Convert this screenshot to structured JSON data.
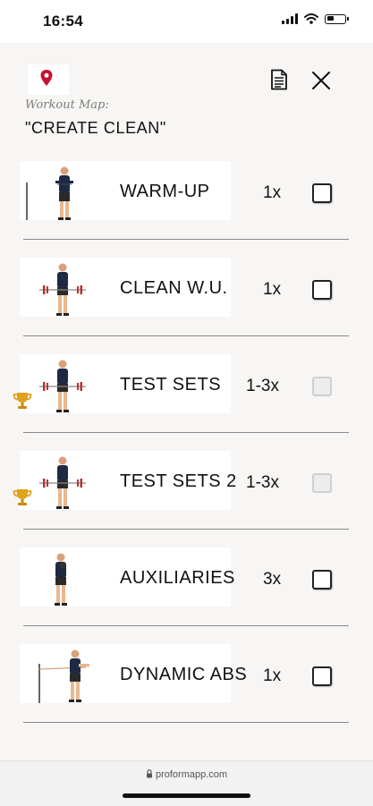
{
  "status_bar": {
    "time": "16:54"
  },
  "header": {
    "icons": [
      "map-pin-icon",
      "document-icon",
      "close-icon"
    ],
    "map_label": "Workout Map:",
    "title": "\"CREATE CLEAN\""
  },
  "workouts": [
    {
      "name": "WARM-UP",
      "reps": "1x",
      "trophy": false,
      "checkbox_enabled": true,
      "checked": false,
      "icon": "athlete-pvc-stick-icon"
    },
    {
      "name": "CLEAN W.U.",
      "reps": "1x",
      "trophy": false,
      "checkbox_enabled": true,
      "checked": false,
      "icon": "athlete-barbell-icon"
    },
    {
      "name": "TEST SETS",
      "reps": "1-3x",
      "trophy": true,
      "checkbox_enabled": false,
      "checked": false,
      "icon": "athlete-barbell-icon"
    },
    {
      "name": "TEST SETS 2",
      "reps": "1-3x",
      "trophy": true,
      "checkbox_enabled": false,
      "checked": false,
      "icon": "athlete-barbell-icon"
    },
    {
      "name": "AUXILIARIES",
      "reps": "3x",
      "trophy": false,
      "checkbox_enabled": true,
      "checked": false,
      "icon": "athlete-kettlebell-icon"
    },
    {
      "name": "DYNAMIC ABS",
      "reps": "1x",
      "trophy": false,
      "checkbox_enabled": true,
      "checked": false,
      "icon": "athlete-band-icon"
    }
  ],
  "browser": {
    "url": "proformapp.com"
  },
  "colors": {
    "pin": "#c8102e",
    "barbell_plate": "#b5342f",
    "divider": "#8a8a8a",
    "disabled_checkbox": "#ededed",
    "trophy": "#e0a21b"
  }
}
